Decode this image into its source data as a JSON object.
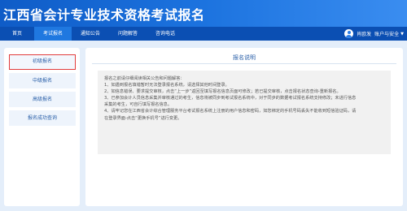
{
  "site_title": "江西省会计专业技术资格考试报名",
  "nav": {
    "items": [
      {
        "label": "首页",
        "active": false
      },
      {
        "label": "考试报名",
        "active": true
      },
      {
        "label": "通知公告",
        "active": false
      },
      {
        "label": "问题解答",
        "active": false
      },
      {
        "label": "咨询电话",
        "active": false
      }
    ],
    "user_name": "肖欧发",
    "account_menu": "账户与安全",
    "account_caret": "▼"
  },
  "sidebar": {
    "items": [
      {
        "label": "初级报名",
        "active": true
      },
      {
        "label": "中级报名",
        "active": false
      },
      {
        "label": "高级报名",
        "active": false
      },
      {
        "label": "报名成功查询",
        "active": false
      }
    ]
  },
  "main": {
    "title": "报名说明",
    "notice_lines": [
      "报名之前请仔细阅读相关公告和问题解答：",
      "1、如遇到报名填错暂时无法登录报名系统，请选择其他时间登录。",
      "2、如信息错误、要求提交审核，点击“上一步”返回至填写报名信息页面可修改；若已提交审核，点击报名状态查询-重新报名。",
      "3、已参加会计人员信息采集并审核通过的考生，信息将被同步到考试报名系统中，对于同步的数据考试报名系统支持修改；未进行信息",
      "采集的考生，可自行填写报名信息。",
      "4、请牢记您在江西省会计综合管理服务平台考试报名系统上注册的用户信息和密码，如您绑定的手机号码丢失不能收到短信验证码，请",
      "在登录界面-点击“更换手机号”进行变更。"
    ]
  }
}
